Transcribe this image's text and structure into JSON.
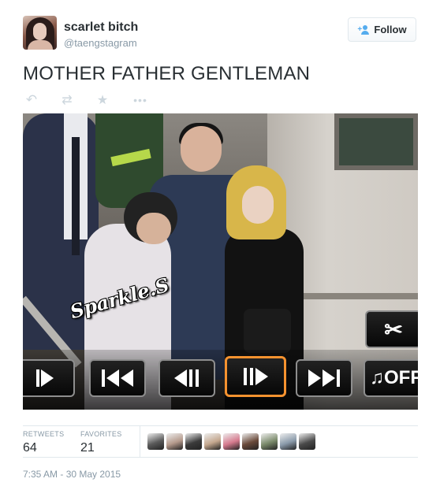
{
  "user": {
    "fullname": "scarlet bitch",
    "screenname": "@taengstagram"
  },
  "follow_button": {
    "label": "Follow"
  },
  "tweet": {
    "text": "MOTHER FATHER GENTLEMAN"
  },
  "media": {
    "watermark": "Sparkle.S",
    "controls": {
      "music_label": "♫OFF",
      "scissors_glyph": "✂"
    }
  },
  "stats": {
    "retweets_label": "RETWEETS",
    "retweets_count": "64",
    "favorites_label": "FAVORITES",
    "favorites_count": "21"
  },
  "favoriters": [
    {
      "color": "#5a5a5a"
    },
    {
      "color": "#b59a8c"
    },
    {
      "color": "#3b3b3b"
    },
    {
      "color": "#c4a78e"
    },
    {
      "color": "#d67a8e"
    },
    {
      "color": "#6a4a3a"
    },
    {
      "color": "#7a8a6a"
    },
    {
      "color": "#8a9aaa"
    },
    {
      "color": "#4a4a4a"
    }
  ],
  "timestamp": "7:35 AM - 30 May 2015",
  "colors": {
    "accent": "#55acee",
    "text": "#292f33",
    "muted": "#8899a6",
    "selected_control": "#f5922f"
  }
}
